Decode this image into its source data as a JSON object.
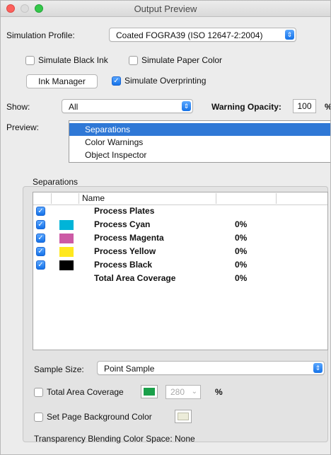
{
  "window": {
    "title": "Output Preview"
  },
  "simulation": {
    "label": "Simulation Profile:",
    "value": "Coated FOGRA39 (ISO 12647-2:2004)",
    "simulate_black_ink": "Simulate Black Ink",
    "simulate_paper_color": "Simulate Paper Color",
    "ink_manager": "Ink Manager",
    "simulate_overprinting": "Simulate Overprinting"
  },
  "show": {
    "label": "Show:",
    "value": "All",
    "warning_label": "Warning Opacity:",
    "warning_value": "100",
    "warning_unit": "%"
  },
  "preview": {
    "label": "Preview:",
    "items": [
      "Separations",
      "Color Warnings",
      "Object Inspector"
    ]
  },
  "separations": {
    "section_label": "Separations",
    "col_name": "Name",
    "rows": [
      {
        "name": "Process Plates",
        "value": "",
        "checked": true,
        "color": ""
      },
      {
        "name": "Process Cyan",
        "value": "0%",
        "checked": true,
        "color": "#00b4d8"
      },
      {
        "name": "Process Magenta",
        "value": "0%",
        "checked": true,
        "color": "#cc5aa5"
      },
      {
        "name": "Process Yellow",
        "value": "0%",
        "checked": true,
        "color": "#ffe81e"
      },
      {
        "name": "Process Black",
        "value": "0%",
        "checked": true,
        "color": "#000000"
      },
      {
        "name": "Total Area Coverage",
        "value": "0%",
        "checked": false,
        "color": ""
      }
    ]
  },
  "sample": {
    "label": "Sample Size:",
    "value": "Point Sample"
  },
  "tac": {
    "label": "Total Area Coverage",
    "value": "280",
    "unit": "%",
    "color": "#1aa04a"
  },
  "page_bg": {
    "label": "Set Page Background Color",
    "color": "#ececd9"
  },
  "blend": {
    "text": "Transparency Blending Color Space:  None"
  }
}
